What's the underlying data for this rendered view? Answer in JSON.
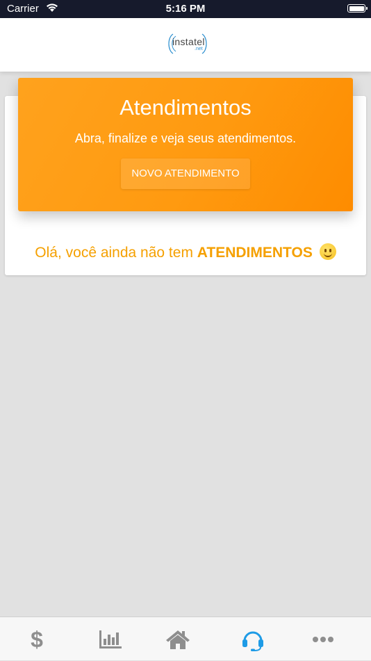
{
  "status_bar": {
    "carrier": "Carrier",
    "time": "5:16 PM",
    "wifi_icon": "wifi-icon",
    "battery_icon": "battery-icon"
  },
  "header": {
    "logo_text": "instatel",
    "logo_sub": ".net"
  },
  "banner": {
    "title": "Atendimentos",
    "subtitle": "Abra, finalize e veja seus atendimentos.",
    "button_label": "NOVO ATENDIMENTO",
    "gradient_start": "#ffa21d",
    "gradient_end": "#fe8c00"
  },
  "empty_state": {
    "prefix": "Olá, você ainda não tem",
    "highlight": "ATENDIMENTOS",
    "color": "#f5a000"
  },
  "tab_bar": {
    "active_color": "#1e9be6",
    "inactive_color": "#8e8e8e",
    "active_tab": "support",
    "tabs": [
      {
        "name": "finance",
        "icon": "dollar-icon"
      },
      {
        "name": "charts",
        "icon": "bar-chart-icon"
      },
      {
        "name": "home",
        "icon": "home-icon"
      },
      {
        "name": "support",
        "icon": "headset-icon"
      },
      {
        "name": "more",
        "icon": "ellipsis-icon"
      }
    ]
  }
}
